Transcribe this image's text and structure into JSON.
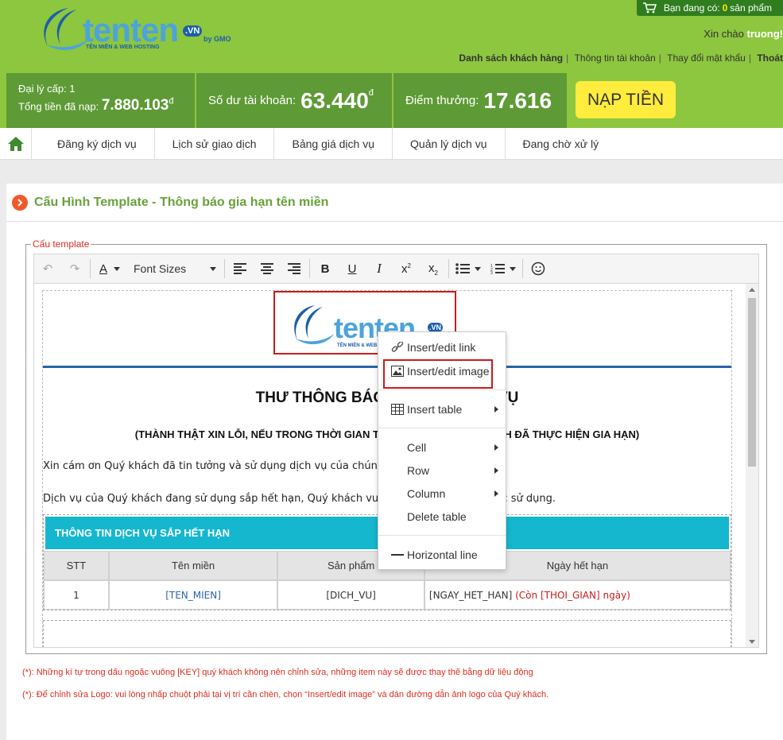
{
  "header": {
    "logo_text": "tenten",
    "logo_sub": "TÊN MIỀN & WEB HOSTING",
    "logo_vn": ".VN",
    "logo_gmo": "by GMO",
    "cart_label": "Bạn đang có:",
    "cart_count": "0",
    "cart_suffix": "sản phẩm",
    "greeting": "Xin chào",
    "username": "truong!",
    "links": [
      "Danh sách khách hàng",
      "Thông tin tài khoản",
      "Thay đổi mật khẩu",
      "Thoát"
    ]
  },
  "balance": {
    "agent_level": "Đại lý cấp: 1",
    "total_label": "Tổng tiền đã nạp:",
    "total_value": "7.880.103",
    "currency": "đ",
    "balance_label": "Số dư tài khoản:",
    "balance_value": "63.440",
    "points_label": "Điểm thưởng:",
    "points_value": "17.616",
    "topup_label": "NẠP TIỀN"
  },
  "nav": {
    "items": [
      "Đăng ký dịch vụ",
      "Lịch sử giao dịch",
      "Bảng giá dịch vụ",
      "Quản lý dịch vụ",
      "Đang chờ xử lý"
    ]
  },
  "page": {
    "title": "Cấu Hình Template - Thông báo gia hạn tên miền",
    "legend": "Cấu template"
  },
  "toolbar": {
    "font_sizes": "Font Sizes",
    "font_color_letter": "A",
    "bold": "B",
    "underline": "U",
    "italic": "I"
  },
  "editor": {
    "mail_title": "THƯ THÔNG BÁO GIA HẠN DỊCH VỤ",
    "mail_subtitle": "(THÀNH THẬT XIN LỖI, NẾU TRONG THỜI GIAN THƯ ĐẾN ĐÂY, QUÝ KHÁCH ĐÃ THỰC HIỆN GIA HẠN)",
    "para1": "Xin cám ơn Quý khách đã tin tưởng và sử dụng dịch vụ của chúng tôi.",
    "para2": "Dịch vụ của Quý khách đang sử dụng sắp hết hạn, Quý khách vui lòng gia hạn để tiếp tục sử dụng.",
    "table_title": "THÔNG TIN DỊCH VỤ SẮP HẾT HẠN",
    "table_headers": [
      "STT",
      "Tên miền",
      "Sản phẩm",
      "Ngày hết hạn"
    ],
    "row": {
      "stt": "1",
      "domain": "[TEN_MIEN]",
      "product": "[DICH_VU]",
      "expiry": "[NGAY_HET_HAN]",
      "remaining_open": "(Còn",
      "remaining_key": "[THOI_GIAN]",
      "remaining_close": "ngày)"
    }
  },
  "context_menu": {
    "items": [
      {
        "label": "Insert/edit link",
        "icon": "link-icon"
      },
      {
        "label": "Insert/edit image",
        "icon": "image-icon"
      },
      {
        "label": "Insert table",
        "icon": "table-icon"
      },
      {
        "label": "Cell"
      },
      {
        "label": "Row"
      },
      {
        "label": "Column"
      },
      {
        "label": "Delete table"
      },
      {
        "label": "Horizontal line",
        "icon": "horizontal-line-icon"
      }
    ]
  },
  "notes": [
    "(*): Những kí tự trong dấu ngoặc vuông [KEY] quý khách không nên chỉnh sửa, những item này sẽ được thay thế bằng dữ liệu động",
    "(*): Để chỉnh sửa Logo: vui lòng nhấp chuột phải tại vị trí cần chèn, chọn “Insert/edit image” và dán đường dẫn ảnh logo của Quý khách."
  ],
  "colors": {
    "header_green": "#8dc63f",
    "balance_dark_green": "#5e9a35",
    "topup_yellow": "#ffec3d",
    "title_green": "#6aa13b",
    "table_header_cyan": "#15b7cf",
    "highlight_red": "#cc1b1b",
    "brand_blue": "#2b65a6"
  }
}
